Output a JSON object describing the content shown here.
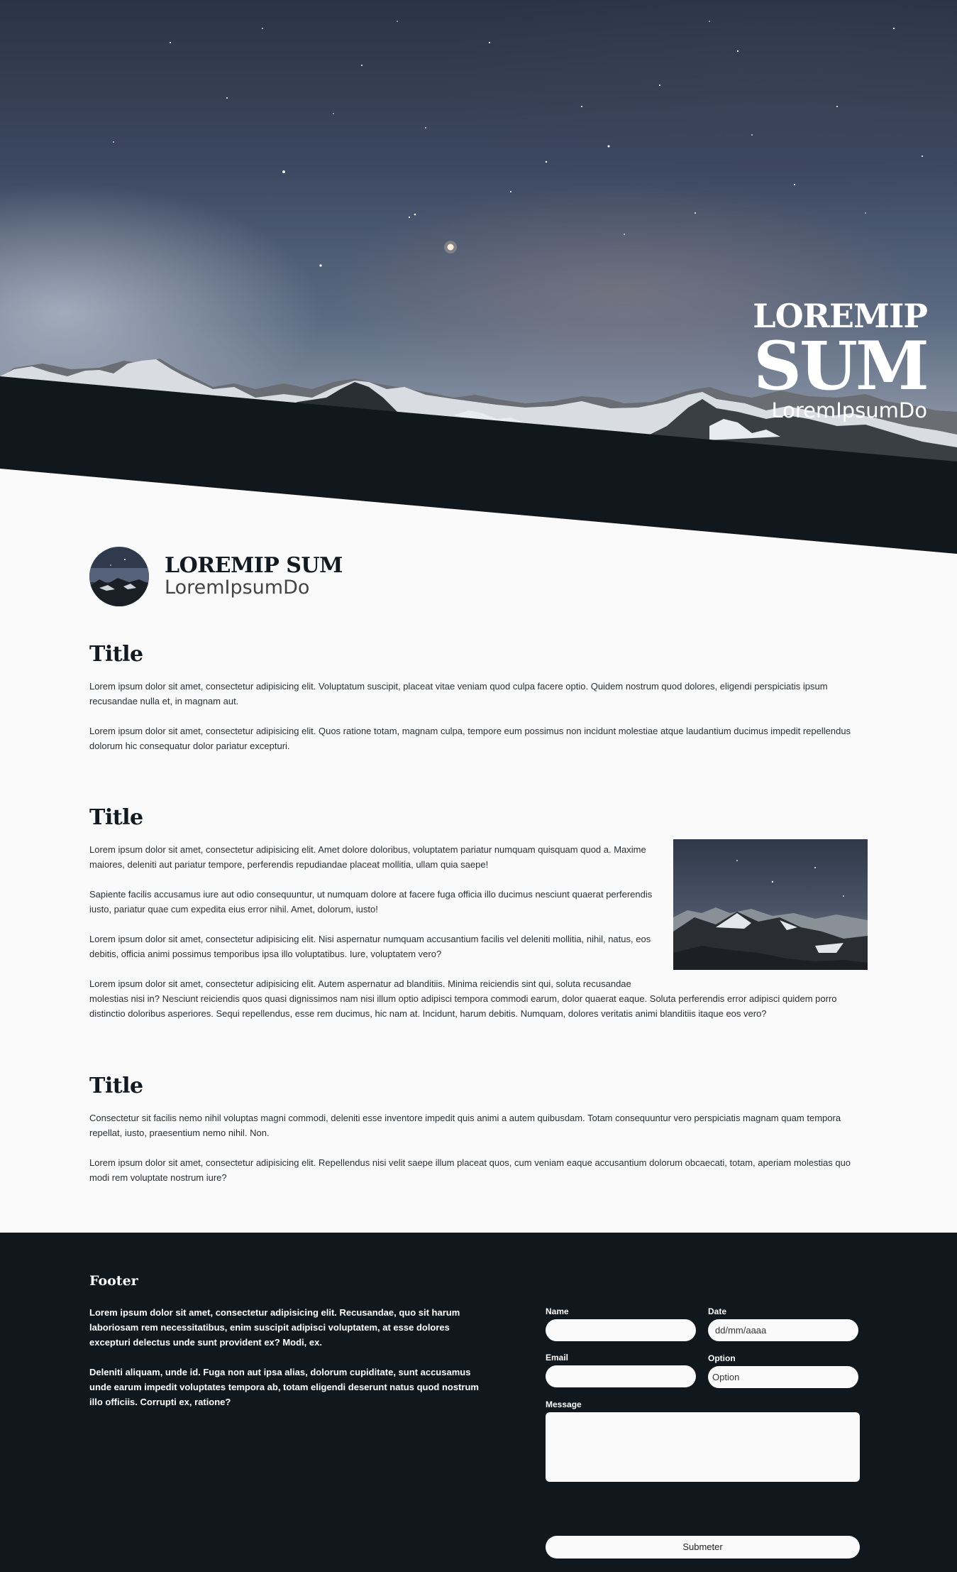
{
  "hero": {
    "line1": "LOREMIP",
    "line2": "SUM",
    "line3": "LoremIpsumDo"
  },
  "profile": {
    "name": "LOREMIP SUM",
    "subtitle": "LoremIpsumDo"
  },
  "sections": [
    {
      "title": "Title",
      "paragraphs": [
        "Lorem ipsum dolor sit amet, consectetur adipisicing elit. Voluptatum suscipit, placeat vitae veniam quod culpa facere optio. Quidem nostrum quod dolores, eligendi perspiciatis ipsum recusandae nulla et, in magnam aut.",
        "Lorem ipsum dolor sit amet, consectetur adipisicing elit. Quos ratione totam, magnam culpa, tempore eum possimus non incidunt molestiae atque laudantium ducimus impedit repellendus dolorum hic consequatur dolor pariatur excepturi."
      ]
    },
    {
      "title": "Title",
      "paragraphs": [
        "Lorem ipsum dolor sit amet, consectetur adipisicing elit. Amet dolore doloribus, voluptatem pariatur numquam quisquam quod a. Maxime maiores, deleniti aut pariatur tempore, perferendis repudiandae placeat mollitia, ullam quia saepe!",
        "Sapiente facilis accusamus iure aut odio consequuntur, ut numquam dolore at facere fuga officia illo ducimus nesciunt quaerat perferendis iusto, pariatur quae cum expedita eius error nihil. Amet, dolorum, iusto!",
        "Lorem ipsum dolor sit amet, consectetur adipisicing elit. Nisi aspernatur numquam accusantium facilis vel deleniti mollitia, nihil, natus, eos debitis, officia animi possimus temporibus ipsa illo voluptatibus. Iure, voluptatem vero?",
        "Lorem ipsum dolor sit amet, consectetur adipisicing elit. Autem aspernatur ad blanditiis. Minima reiciendis sint qui, soluta recusandae molestias nisi in? Nesciunt reiciendis quos quasi dignissimos nam nisi illum optio adipisci tempora commodi earum, dolor quaerat eaque. Soluta perferendis error adipisci quidem porro distinctio doloribus asperiores. Sequi repellendus, esse rem ducimus, hic nam at. Incidunt, harum debitis. Numquam, dolores veritatis animi blanditiis itaque eos vero?"
      ]
    },
    {
      "title": "Title",
      "paragraphs": [
        "Consectetur sit facilis nemo nihil voluptas magni commodi, deleniti esse inventore impedit quis animi a autem quibusdam. Totam consequuntur vero perspiciatis magnam quam tempora repellat, iusto, praesentium nemo nihil. Non.",
        "Lorem ipsum dolor sit amet, consectetur adipisicing elit. Repellendus nisi velit saepe illum placeat quos, cum veniam eaque accusantium dolorum obcaecati, totam, aperiam molestias quo modi rem voluptate nostrum iure?"
      ]
    }
  ],
  "footer": {
    "title": "Footer",
    "paragraphs": [
      "Lorem ipsum dolor sit amet, consectetur adipisicing elit. Recusandae, quo sit harum laboriosam rem necessitatibus, enim suscipit adipisci voluptatem, at esse dolores excepturi delectus unde sunt provident ex? Modi, ex.",
      "Deleniti aliquam, unde id. Fuga non aut ipsa alias, dolorum cupiditate, sunt accusamus unde earum impedit voluptates tempora ab, totam eligendi deserunt natus quod nostrum illo officiis. Corrupti ex, ratione?"
    ],
    "form": {
      "name_label": "Name",
      "name_value": "",
      "date_label": "Date",
      "date_placeholder": "dd/mm/aaaa",
      "email_label": "Email",
      "email_value": "",
      "option_label": "Option",
      "option_value": "Option",
      "message_label": "Message",
      "message_value": "",
      "submit_label": "Submeter"
    }
  },
  "colors": {
    "dark": "#10181e",
    "page_bg": "#fafafa",
    "text": "#2a2f33"
  }
}
